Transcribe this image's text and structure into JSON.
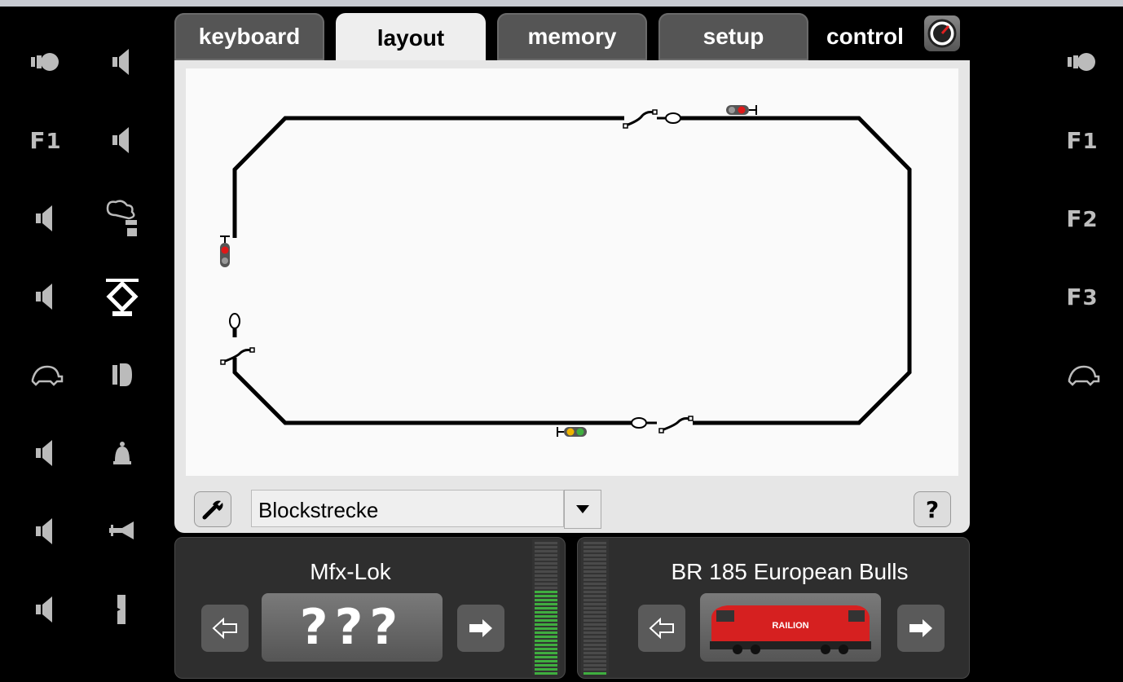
{
  "tabs": [
    {
      "label": "keyboard",
      "active": false
    },
    {
      "label": "layout",
      "active": true
    },
    {
      "label": "memory",
      "active": false
    },
    {
      "label": "setup",
      "active": false
    }
  ],
  "control": {
    "label": "control",
    "icon": "speedometer-icon"
  },
  "left_functions_col1": [
    {
      "icon": "headlight-icon"
    },
    {
      "icon": "f1-icon",
      "text": "F",
      "sub": "1"
    },
    {
      "icon": "sound-icon"
    },
    {
      "icon": "sound-icon"
    },
    {
      "icon": "turtle-icon"
    },
    {
      "icon": "sound-icon"
    },
    {
      "icon": "sound-icon"
    },
    {
      "icon": "sound-icon"
    }
  ],
  "left_functions_col2": [
    {
      "icon": "sound-icon"
    },
    {
      "icon": "sound-icon"
    },
    {
      "icon": "smoke-icon"
    },
    {
      "icon": "pantograph-icon",
      "active": true
    },
    {
      "icon": "cab-light-icon"
    },
    {
      "icon": "bell-icon"
    },
    {
      "icon": "horn-icon"
    },
    {
      "icon": "door-icon"
    }
  ],
  "right_functions": [
    {
      "icon": "headlight-icon"
    },
    {
      "icon": "f1-icon",
      "text": "F",
      "sub": "1"
    },
    {
      "icon": "f2-icon",
      "text": "F",
      "sub": "2"
    },
    {
      "icon": "f3-icon",
      "text": "F",
      "sub": "3"
    },
    {
      "icon": "turtle-icon"
    }
  ],
  "layout_select": {
    "value": "Blockstrecke"
  },
  "help_label": "?",
  "locos": [
    {
      "name": "Mfx-Lok",
      "image_text": "???",
      "speed_fraction": 0.65
    },
    {
      "name": "BR 185 European Bulls",
      "image_text": "RAILION",
      "speed_fraction": 0.03
    }
  ],
  "colors": {
    "accent_green": "#3fae3f",
    "signal_red": "#e01818",
    "signal_yellow": "#f0b400",
    "tab_inactive": "#555555"
  }
}
